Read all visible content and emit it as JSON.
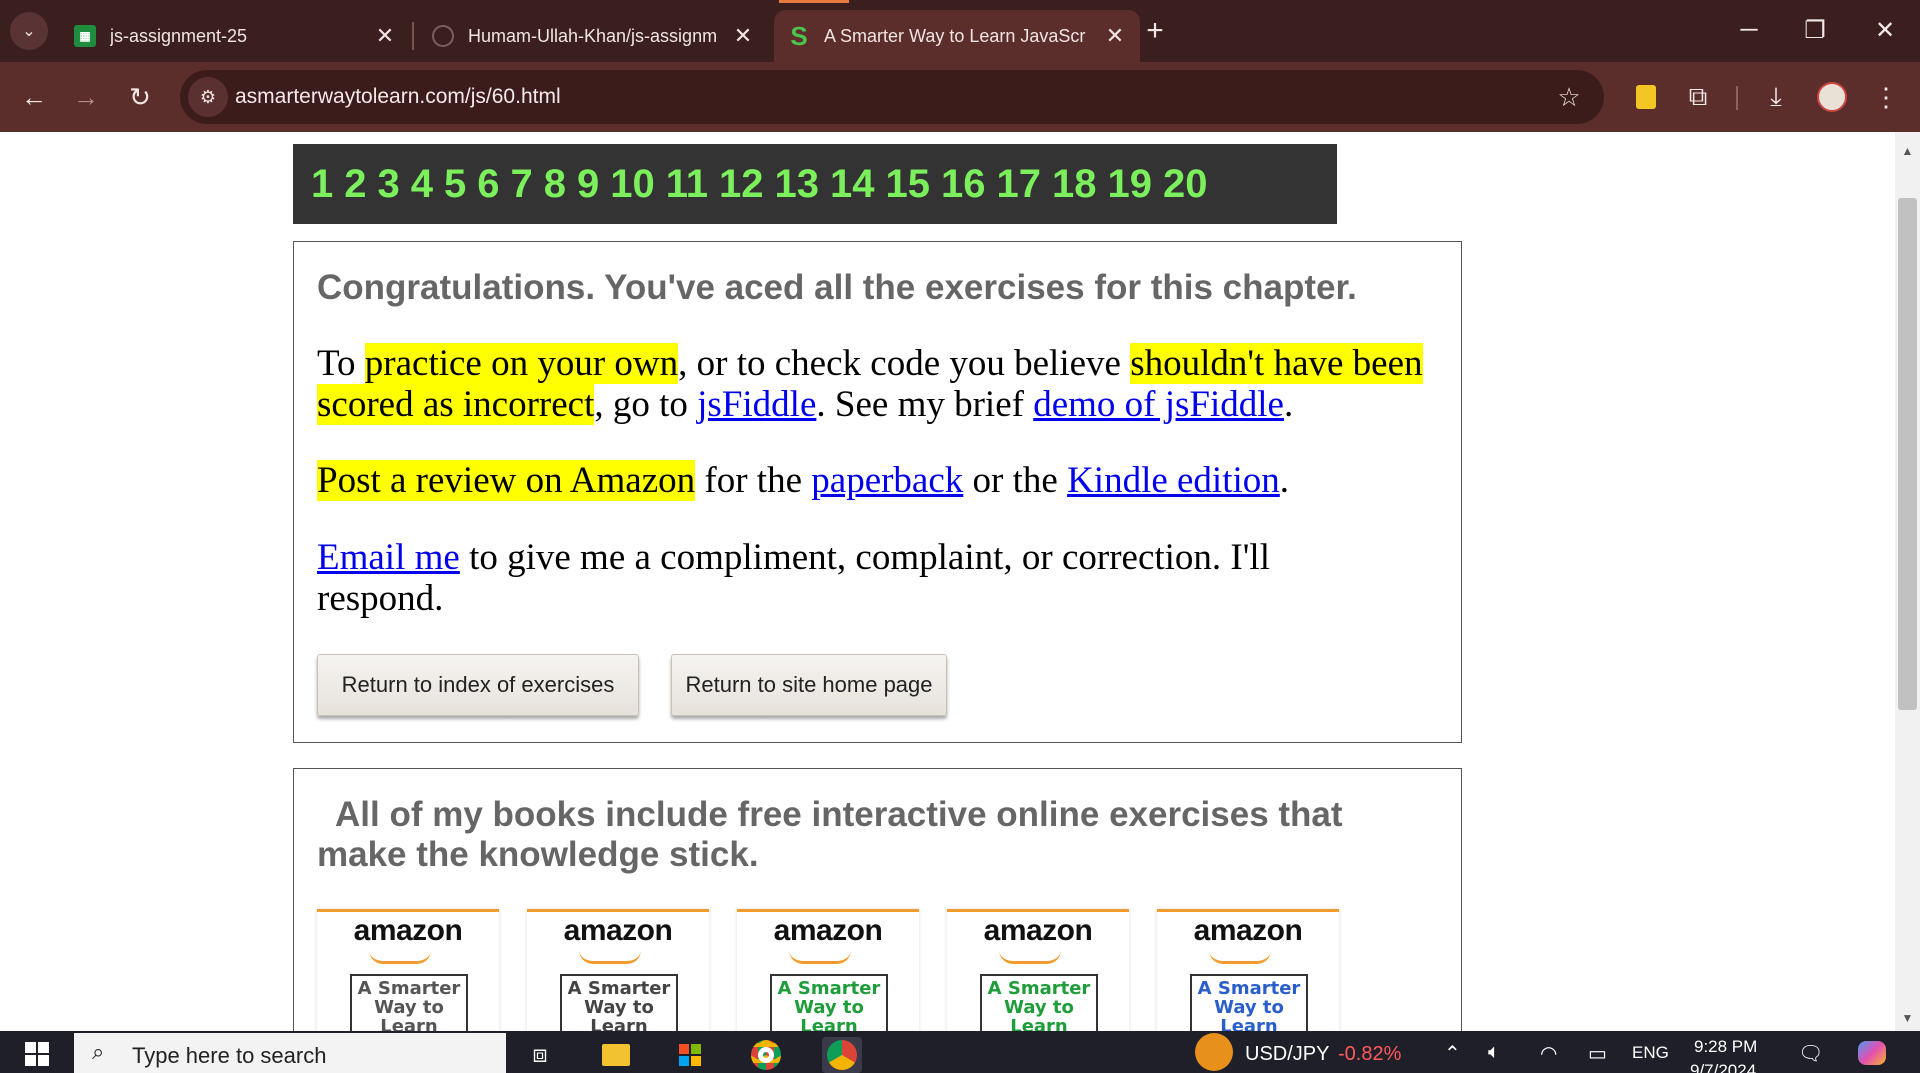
{
  "browser": {
    "tabs": [
      {
        "title": "js-assignment-25",
        "favicon": "sheets-icon",
        "active": false
      },
      {
        "title": "Humam-Ullah-Khan/js-assignm",
        "favicon": "github-icon",
        "active": false
      },
      {
        "title": "A Smarter Way to Learn JavaScr",
        "favicon": "s-logo-icon",
        "active": true
      }
    ],
    "url": "asmarterwaytolearn.com/js/60.html"
  },
  "page": {
    "exercise_numbers": [
      "1",
      "2",
      "3",
      "4",
      "5",
      "6",
      "7",
      "8",
      "9",
      "10",
      "11",
      "12",
      "13",
      "14",
      "15",
      "16",
      "17",
      "18",
      "19",
      "20"
    ],
    "congrats_heading": "Congratulations. You've aced all the exercises for this chapter.",
    "para1": {
      "t1": "To ",
      "h1": "practice on your own",
      "t2": ", or to check code you believe ",
      "h2": "shouldn't have been scored as incorrect",
      "t3": ", go to ",
      "l1": "jsFiddle",
      "t4": ". See my brief ",
      "l2": "demo of jsFiddle",
      "t5": "."
    },
    "para2": {
      "h1": "Post a review on Amazon",
      "t1": " for the ",
      "l1": "paperback",
      "t2": " or the ",
      "l2": "Kindle edition",
      "t3": "."
    },
    "para3": {
      "l1": "Email me",
      "t1": " to give me a compliment, complaint, or correction. I'll respond."
    },
    "buttons": {
      "index": "Return to index of exercises",
      "home": "Return to site home page"
    },
    "books_heading": "All of my books include free interactive online exercises that make the knowledge stick.",
    "books": [
      {
        "store": "amazon",
        "cover": "A Smarter Way to Learn",
        "color": "#555555"
      },
      {
        "store": "amazon",
        "cover": "A Smarter Way to Learn Python",
        "color": "#444444"
      },
      {
        "store": "amazon",
        "cover": "A Smarter Way to Learn",
        "color": "#1f9d3a"
      },
      {
        "store": "amazon",
        "cover": "A Smarter Way to Learn",
        "color": "#1f9d3a"
      },
      {
        "store": "amazon",
        "cover": "A Smarter Way to Learn",
        "color": "#2a5fc9"
      }
    ]
  },
  "taskbar": {
    "search_placeholder": "Type here to search",
    "stock_label": "USD/JPY",
    "stock_change": "-0.82%",
    "language": "ENG",
    "time": "9:28 PM",
    "date": "9/7/2024"
  }
}
